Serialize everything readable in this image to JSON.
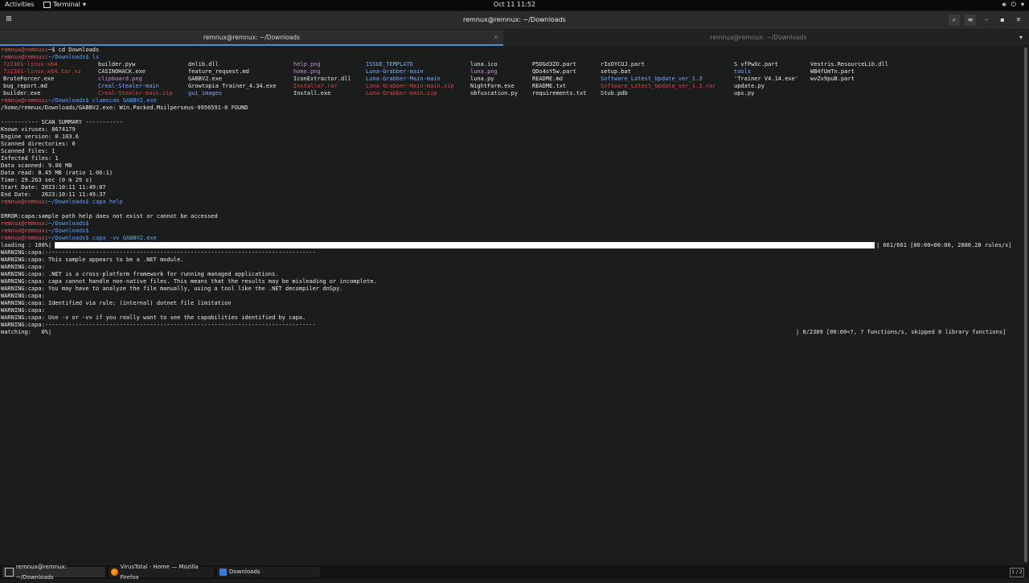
{
  "topbar": {
    "activities": "Activities",
    "app_menu": "Terminal",
    "clock": "Oct 11  11:52"
  },
  "window": {
    "title": "remnux@remnux: ~/Downloads",
    "tabs": [
      {
        "label": "remnux@remnux: ~/Downloads",
        "active": true
      },
      {
        "label": "remnux@remnux: ~/Downloads",
        "active": false
      }
    ]
  },
  "terminal": {
    "prompt_user": "remnux@remnux",
    "prompt_sep": ":",
    "cmd1": "~$ cd Downloads",
    "cmd2": "~/Downloads$ ls",
    "ls_rows": [
      [
        "7z2301-linux-x64",
        "builder.pyw",
        "dnlib.dll",
        "help.png",
        "ISSUE_TEMPLATE",
        "luna.ico",
        "P5OGd3ZO.part",
        "rIoOYCUJ.part",
        "S vfPwXc.part",
        "Vestris.ResourceLib.dll"
      ],
      [
        "7z2301-linux-x64.tar.xz",
        "CASINOHACK.exe",
        "feature_request.md",
        "home.png",
        "Luna-Grabber-main",
        "luna.png",
        "QDo4sY5w.part",
        "setup.bat",
        "tools",
        "WB4fUmTn.part"
      ],
      [
        "BruteForcer.exe",
        "clipboard.png",
        "GABBV2.exe",
        "IconExtractor.dll",
        "Luna-Grabber-Main-main",
        "luna.py",
        "README.md",
        "Software_Latest_Update_ver_1.3",
        "'Trainer V4.14.exe'",
        "wvZv9puB.part"
      ],
      [
        "bug_report.md",
        "Creal-Stealer-main",
        "Growtopia Trainer_4.34.exe",
        "Installer.rar",
        "Luna-Grabber-Main-main.zip",
        "NightFarm.exe",
        "README.txt",
        "Software_Latest_Update_ver_1.3.rar",
        "update.py",
        ""
      ],
      [
        "builder.exe",
        "Creal-Stealer-main.zip",
        "gui_images",
        "Install.exe",
        "Luna-Grabber-main.zip",
        "obfuscation.py",
        "requirements.txt",
        "Stub.pdb",
        "upx.py",
        ""
      ]
    ],
    "cmd3": "~/Downloads$ clamscan GABBV2.exe",
    "clam_found": "/home/remnux/Downloads/GABBV2.exe: Win.Packed.Msilperseus-9956591-0 FOUND",
    "summary": [
      "----------- SCAN SUMMARY -----------",
      "Known viruses: 8674179",
      "Engine version: 0.103.6",
      "Scanned directories: 0",
      "Scanned files: 1",
      "Infected files: 1",
      "Data scanned: 9.00 MB",
      "Data read: 8.45 MB (ratio 1.06:1)",
      "Time: 29.263 sec (0 m 29 s)",
      "Start Date: 2023:10:11 11:49:07",
      "End Date:   2023:10:11 11:49:37"
    ],
    "cmd4": "~/Downloads$ capa help",
    "capa_error": "ERROR:capa:sample path help does not exist or cannot be accessed",
    "cmd5": "~/Downloads$",
    "cmd6": "~/Downloads$",
    "cmd7": "~/Downloads$ capa -vv GABBV2.exe",
    "loading_label": "loading : 100%|",
    "loading_stats": "| 661/661 [00:00<00:00, 2880.28 rules/s]",
    "loading_percent": 100,
    "warnings": [
      "WARNING:capa:--------------------------------------------------------------------------------",
      "WARNING:capa: This sample appears to be a .NET module.",
      "WARNING:capa:",
      "WARNING:capa: .NET is a cross-platform framework for running managed applications.",
      "WARNING:capa: capa cannot handle non-native files. This means that the results may be misleading or incomplete.",
      "WARNING:capa: You may have to analyze the file manually, using a tool like the .NET decompiler dnSpy.",
      "WARNING:capa:",
      "WARNING:capa: Identified via rule: (internal) dotnet file limitation",
      "WARNING:capa:",
      "WARNING:capa: Use -v or -vv if you really want to see the capabilities identified by capa.",
      "WARNING:capa:--------------------------------------------------------------------------------"
    ],
    "matching_label": "matching:   0%|",
    "matching_stats": "| 0/2309 [00:00<?, ? functions/s, skipped 0 library functions]"
  },
  "taskbar": {
    "items": [
      {
        "label": "remnux@remnux: ~/Downloads",
        "icon": "terminal-icon"
      },
      {
        "label": "VirusTotal - Home — Mozilla Firefox",
        "icon": "firefox-icon"
      },
      {
        "label": "Downloads",
        "icon": "folder-icon"
      }
    ],
    "pager": "1 / 2"
  },
  "colors": {
    "prompt": "#e05a5a",
    "path": "#5aa0ff",
    "background": "#1b1c1c",
    "accent": "#4a90d9"
  }
}
